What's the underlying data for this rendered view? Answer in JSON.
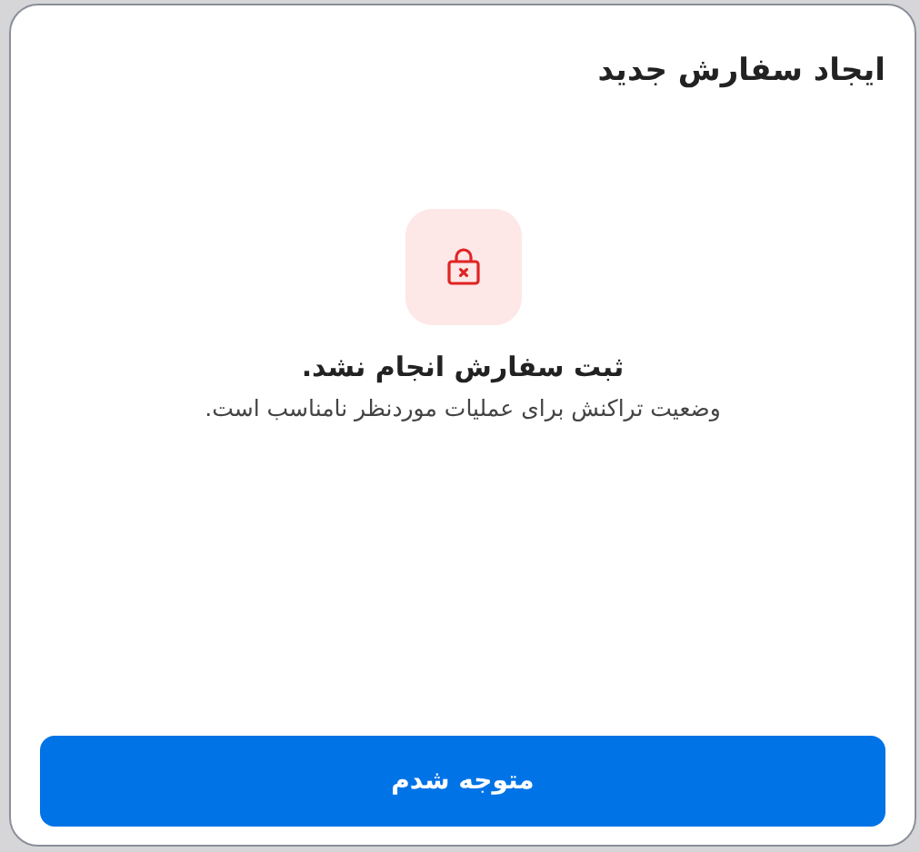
{
  "dialog": {
    "title": "ایجاد سفارش جدید",
    "message": {
      "heading": "ثبت سفارش انجام نشد.",
      "detail": "وضعیت تراکنش برای عملیات موردنظر نامناسب است."
    },
    "button": "متوجه شدم"
  }
}
